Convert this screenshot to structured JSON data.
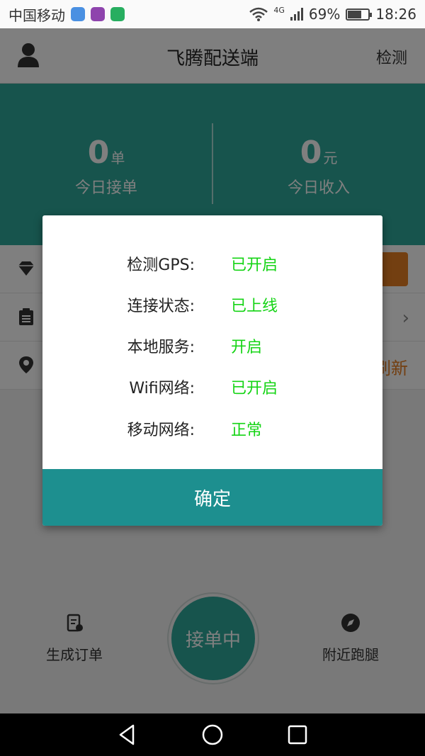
{
  "status_bar": {
    "carrier": "中国移动",
    "network": "4G",
    "battery_text": "69%",
    "battery_level": 0.69,
    "time": "18:26",
    "icons": [
      "location-app-icon",
      "gallery-app-icon",
      "shop-app-icon",
      "wifi-icon",
      "signal-icon",
      "battery-icon"
    ]
  },
  "header": {
    "title": "飞腾配送端",
    "detect_label": "检测",
    "avatar_icon": "person-icon"
  },
  "stats": {
    "orders": {
      "value": "0",
      "unit": "单",
      "label": "今日接单"
    },
    "income": {
      "value": "0",
      "unit": "元",
      "label": "今日收入"
    }
  },
  "rows": [
    {
      "icon": "diamond-icon"
    },
    {
      "icon": "clipboard-icon"
    },
    {
      "icon": "location-pin-icon",
      "action": "刷新"
    }
  ],
  "bottom_bar": {
    "create_order": "生成订单",
    "taking_orders": "接单中",
    "nearby_errand": "附近跑腿"
  },
  "dialog": {
    "items": [
      {
        "key": "检测GPS:",
        "value": "已开启"
      },
      {
        "key": "连接状态:",
        "value": "已上线"
      },
      {
        "key": "本地服务:",
        "value": "开启"
      },
      {
        "key": "Wifi网络:",
        "value": "已开启"
      },
      {
        "key": "移动网络:",
        "value": "正常"
      }
    ],
    "confirm_label": "确定"
  },
  "colors": {
    "brand_teal": "#2ea99a",
    "dialog_button": "#1d8f8f",
    "status_green": "#14d414",
    "accent_orange": "#e67e22"
  }
}
